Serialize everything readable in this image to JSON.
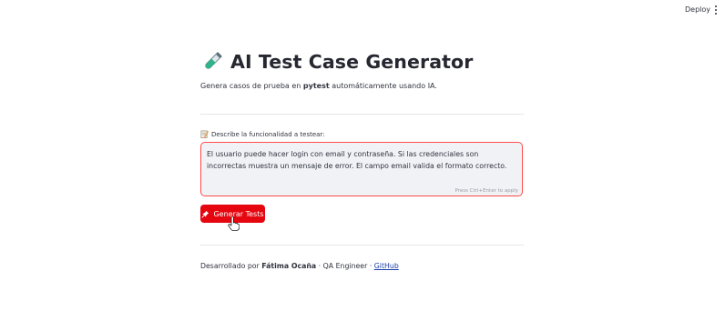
{
  "topbar": {
    "deploy_label": "Deploy",
    "menu_icon": "more-vertical-icon"
  },
  "header": {
    "icon": "test-tube-icon",
    "title": "AI Test Case Generator",
    "subtitle_pre": "Genera casos de prueba en ",
    "subtitle_bold": "pytest",
    "subtitle_post": " automáticamente usando IA."
  },
  "form": {
    "label_icon": "memo-icon",
    "label": "Describe la funcionalidad a testear:",
    "textarea_value": "El usuario puede hacer login con email y contraseña. Si las credenciales son incorrectas muestra un mensaje de error. El campo email valida el formato correcto.",
    "hint": "Press Ctrl+Enter to apply",
    "button_icon": "pushpin-icon",
    "button_label": "Generar Tests"
  },
  "footer": {
    "prefix": "Desarrollado por ",
    "author": "Fátima Ocaña",
    "role": " · QA Engineer · ",
    "link_label": "GitHub"
  },
  "colors": {
    "accent": "#ff4b4b",
    "button": "#e5060f",
    "link": "#1a3fa6"
  }
}
